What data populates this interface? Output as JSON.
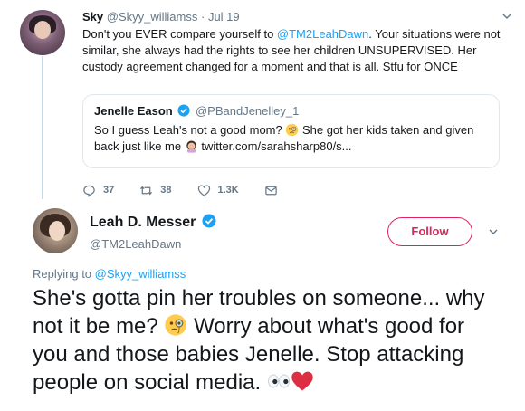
{
  "reply_tweet": {
    "name": "Sky",
    "handle": "@Skyy_williamss",
    "separator": " · ",
    "date": "Jul 19",
    "text_part1": "Don't you EVER compare yourself to ",
    "mention": "@TM2LeahDawn",
    "text_part2": ". Your situations were not similar, she always had the rights to see her children UNSUPERVISED. Her custody agreement changed for a moment and that is all. Stfu for ONCE"
  },
  "quoted_tweet": {
    "name": "Jenelle Eason",
    "handle": "@PBandJenelley_1",
    "text_part1": "So I guess Leah's not a good mom? ",
    "text_part2": " She got her kids taken and given back just like me ",
    "link": "twitter.com/sarahsharp80/s..."
  },
  "actions": {
    "replies": "37",
    "retweets": "38",
    "likes": "1.3K"
  },
  "main_tweet": {
    "name": "Leah D. Messer",
    "handle": "@TM2LeahDawn",
    "follow_label": "Follow",
    "replying_prefix": "Replying to ",
    "replying_handle": "@Skyy_williamss",
    "text_part1": "She's gotta pin her troubles on someone... why not it be me? ",
    "text_part2": " Worry about what's good for you and those babies Jenelle. Stop attacking people on social media. "
  },
  "colors": {
    "accent": "#1da1f2",
    "follow": "#e0245e",
    "muted": "#657786",
    "heart": "#e0245e"
  },
  "icons": [
    "chevron-down-icon",
    "verified-badge-icon",
    "reply-icon",
    "retweet-icon",
    "like-icon",
    "message-icon",
    "monocle-face-emoji",
    "woman-facepalming-emoji",
    "eyes-emoji",
    "red-heart-emoji"
  ]
}
